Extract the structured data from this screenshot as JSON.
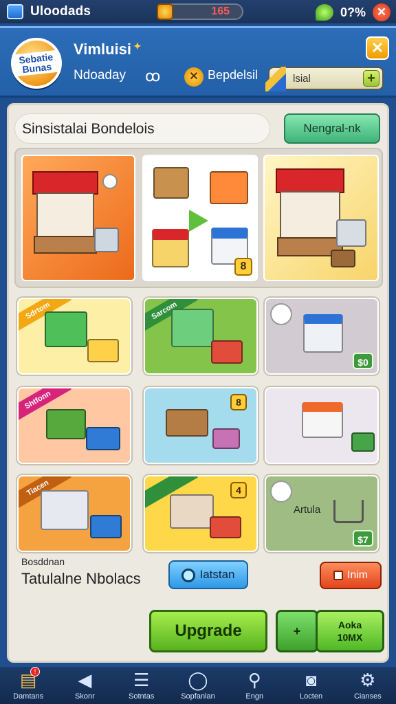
{
  "statusbar": {
    "app_name": "Uloodads",
    "coins": "165",
    "battery": "0?%",
    "close": "✕"
  },
  "header": {
    "logo_text": "Sebatie Bunas",
    "player_name": "Vimluisi",
    "sub_label": "Ndoaday",
    "bonus_label": "Bepdelsil",
    "search_text": "lsial",
    "plus": "+",
    "close": "✕"
  },
  "main": {
    "title": "Sinsistalai Bondelois",
    "top_button": "Nengral-nk",
    "hero_badge": "8",
    "cards": [
      {
        "tag": "Sdrtom"
      },
      {
        "tag": "Sarcom"
      },
      {
        "price": "$0"
      },
      {
        "tag": "Shtfonn"
      },
      {
        "badge": "8"
      },
      {},
      {
        "tag": "Tiacen"
      },
      {
        "badge": "4"
      },
      {
        "label": "Artula",
        "price": "$7"
      }
    ],
    "footer_sub": "Bosddnan",
    "footer_title": "Tatulalne Nbolacs",
    "blue_button": "Iatstan",
    "red_button": "Inim",
    "upgrade_button": "Upgrade",
    "small_button": "+",
    "pack_button_line1": "Aoka",
    "pack_button_line2": "10MX"
  },
  "nav": [
    {
      "label": "Damtans",
      "icon": "book-icon",
      "badge": "!"
    },
    {
      "label": "Skonr",
      "icon": "back-icon"
    },
    {
      "label": "Sotntas",
      "icon": "list-icon"
    },
    {
      "label": "Sopfanlan",
      "icon": "circle-icon"
    },
    {
      "label": "Engn",
      "icon": "search-icon"
    },
    {
      "label": "Locten",
      "icon": "camera-icon"
    },
    {
      "label": "Cianses",
      "icon": "gear-icon"
    }
  ],
  "colors": {
    "header_blue": "#2c6cb8",
    "panel_bg": "#ece9e1",
    "upgrade_green": "#58b21d",
    "accent_red": "#e2441c"
  }
}
